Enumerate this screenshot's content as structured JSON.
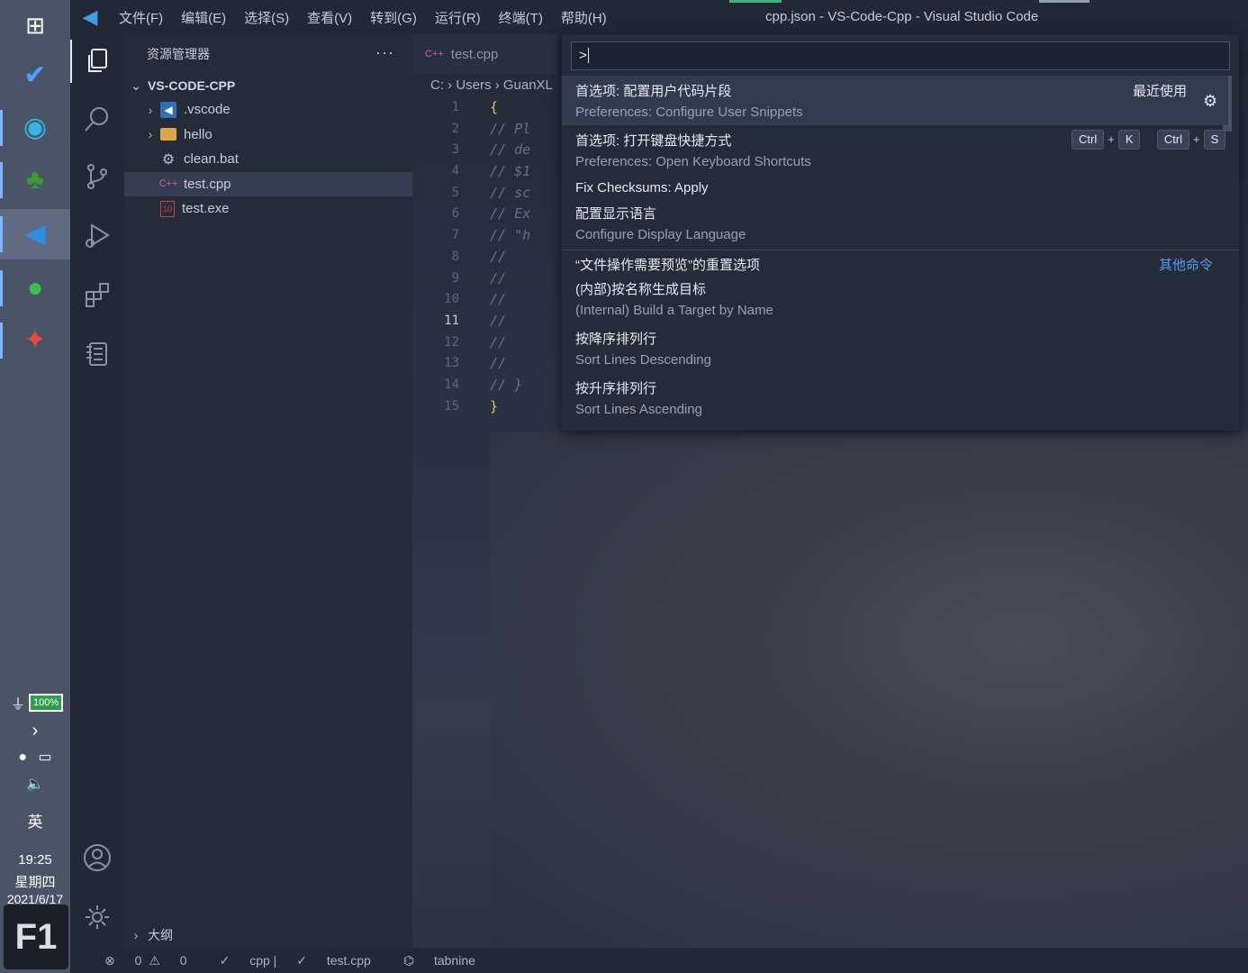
{
  "taskbar": {
    "apps": [
      {
        "name": "windows-start",
        "glyph": "⊞",
        "color": "#ffffff"
      },
      {
        "name": "todo",
        "glyph": "✔",
        "color": "#4da3ff"
      },
      {
        "name": "edge",
        "glyph": "◉",
        "color": "#33b5e5"
      },
      {
        "name": "tree-app",
        "glyph": "♣",
        "color": "#3a9a2e"
      },
      {
        "name": "vscode",
        "glyph": "◀",
        "color": "#2b8fe0"
      },
      {
        "name": "wechat",
        "glyph": "●",
        "color": "#38c04a"
      },
      {
        "name": "other-app",
        "glyph": "✦",
        "color": "#e84a3a"
      }
    ],
    "battery": "100%",
    "ime": "英",
    "time": "19:25",
    "weekday": "星期四",
    "date": "2021/6/17",
    "corner_logo": "F1"
  },
  "titlebar": {
    "menus": [
      "文件(F)",
      "编辑(E)",
      "选择(S)",
      "查看(V)",
      "转到(G)",
      "运行(R)",
      "终端(T)",
      "帮助(H)"
    ],
    "window_title": "cpp.json - VS-Code-Cpp - Visual Studio Code"
  },
  "sidebar": {
    "title": "资源管理器",
    "more": "···",
    "root": "VS-CODE-CPP",
    "items": [
      {
        "label": ".vscode",
        "type": "folder",
        "icon": "vscode-folder-icon"
      },
      {
        "label": "hello",
        "type": "folder",
        "icon": "folder-icon"
      },
      {
        "label": "clean.bat",
        "type": "file",
        "icon": "gear-file-icon"
      },
      {
        "label": "test.cpp",
        "type": "file",
        "icon": "cpp-file-icon"
      },
      {
        "label": "test.exe",
        "type": "file",
        "icon": "exe-file-icon"
      }
    ],
    "outline": "大纲"
  },
  "editor": {
    "tab": "test.cpp",
    "tab_icon": "C++",
    "breadcrumb": [
      "C:",
      "Users",
      "GuanXL"
    ],
    "current_line": "11",
    "lines": [
      {
        "n": "1",
        "text": "{",
        "brace": true
      },
      {
        "n": "2",
        "text": "    // Pl"
      },
      {
        "n": "3",
        "text": "    // de"
      },
      {
        "n": "4",
        "text": "    // $1"
      },
      {
        "n": "5",
        "text": "    // sc"
      },
      {
        "n": "6",
        "text": "    // Ex"
      },
      {
        "n": "7",
        "text": "    // \"h"
      },
      {
        "n": "8",
        "text": "    //"
      },
      {
        "n": "9",
        "text": "    //"
      },
      {
        "n": "10",
        "text": "    //"
      },
      {
        "n": "11",
        "text": "    //"
      },
      {
        "n": "12",
        "text": "    //"
      },
      {
        "n": "13",
        "text": "    //"
      },
      {
        "n": "14",
        "text": "    // }"
      },
      {
        "n": "15",
        "text": "}",
        "brace": true
      }
    ]
  },
  "palette": {
    "input": ">",
    "recently_used": "最近使用",
    "other_commands": "其他命令",
    "items": [
      {
        "main": "首选项: 配置用户代码片段",
        "sub": "Preferences: Configure User Snippets"
      },
      {
        "main": "首选项: 打开键盘快捷方式",
        "sub": "Preferences: Open Keyboard Shortcuts",
        "keys": [
          "Ctrl",
          "K",
          "Ctrl",
          "S"
        ]
      },
      {
        "main": "Fix Checksums: Apply"
      },
      {
        "main": "配置显示语言",
        "sub": "Configure Display Language"
      },
      {
        "main": "“文件操作需要预览”的重置选项"
      },
      {
        "main": "(内部)按名称生成目标",
        "sub": "(Internal) Build a Target by Name"
      },
      {
        "main": "按降序排列行",
        "sub": "Sort Lines Descending"
      },
      {
        "main": "按升序排列行",
        "sub": "Sort Lines Ascending"
      }
    ]
  },
  "statusbar": {
    "errors": "0",
    "warnings": "0",
    "language": "cpp",
    "file": "test.cpp",
    "extension": "tabnine"
  }
}
